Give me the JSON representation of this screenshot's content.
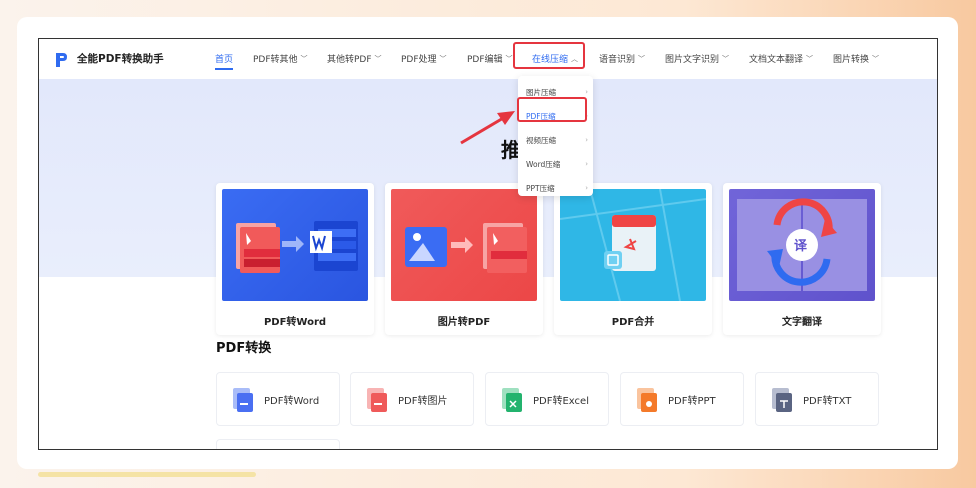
{
  "brand": "全能PDF转换助手",
  "nav": [
    {
      "label": "首页",
      "chevron": false
    },
    {
      "label": "PDF转其他",
      "chevron": true
    },
    {
      "label": "其他转PDF",
      "chevron": true
    },
    {
      "label": "PDF处理",
      "chevron": true
    },
    {
      "label": "PDF编辑",
      "chevron": true
    },
    {
      "label": "在线压缩",
      "chevron": true
    },
    {
      "label": "语音识别",
      "chevron": true
    },
    {
      "label": "图片文字识别",
      "chevron": true
    },
    {
      "label": "文档文本翻译",
      "chevron": true
    },
    {
      "label": "图片转换",
      "chevron": true
    }
  ],
  "dropdown": [
    "图片压缩",
    "PDF压缩",
    "视频压缩",
    "Word压缩",
    "PPT压缩"
  ],
  "hero_title_partial": "推",
  "cards": [
    {
      "label": "PDF转Word"
    },
    {
      "label": "图片转PDF"
    },
    {
      "label": "PDF合并"
    },
    {
      "label": "文字翻译"
    }
  ],
  "translate_glyph": "译",
  "section_title": "PDF转换",
  "tools": [
    {
      "label": "PDF转Word",
      "color": "#4a6ff2"
    },
    {
      "label": "PDF转图片",
      "color": "#ef5a5a"
    },
    {
      "label": "PDF转Excel",
      "color": "#23b36e"
    },
    {
      "label": "PDF转PPT",
      "color": "#f47a2a"
    },
    {
      "label": "PDF转TXT",
      "color": "#5a6482"
    }
  ],
  "colors": {
    "accent": "#2f6bf0",
    "highlight": "#e5353f"
  }
}
